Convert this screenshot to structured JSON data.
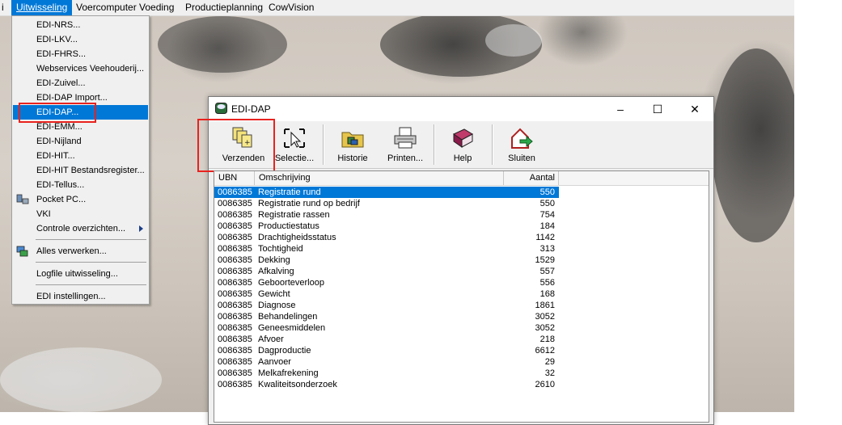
{
  "menubar": {
    "items": [
      {
        "label": "i"
      },
      {
        "label": "Uitwisseling"
      },
      {
        "label": "Voercomputer"
      },
      {
        "label": "Voeding"
      },
      {
        "label": "Productieplanning"
      },
      {
        "label": "CowVision"
      }
    ]
  },
  "dropdown": {
    "items": [
      {
        "label": "EDI-NRS..."
      },
      {
        "label": "EDI-LKV..."
      },
      {
        "label": "EDI-FHRS..."
      },
      {
        "label": "Webservices Veehouderij..."
      },
      {
        "label": "EDI-Zuivel..."
      },
      {
        "label": "EDI-DAP Import..."
      },
      {
        "label": "EDI-DAP..."
      },
      {
        "label": "EDI-EMM..."
      },
      {
        "label": "EDI-Nijland"
      },
      {
        "label": "EDI-HIT..."
      },
      {
        "label": "EDI-HIT Bestandsregister..."
      },
      {
        "label": "EDI-Tellus..."
      },
      {
        "label": "Pocket PC..."
      },
      {
        "label": "VKI"
      },
      {
        "label": "Controle overzichten..."
      },
      {
        "label": "Alles verwerken..."
      },
      {
        "label": "Logfile uitwisseling..."
      },
      {
        "label": "EDI instellingen..."
      }
    ],
    "selected": "EDI-DAP...",
    "submenu_icon": "chevron-right-icon"
  },
  "dialog": {
    "title": "EDI-DAP",
    "toolbar": [
      {
        "label": "Verzenden",
        "icon": "send-documents-icon"
      },
      {
        "label": "Selectie...",
        "icon": "selection-cursor-icon"
      },
      {
        "label": "Historie",
        "icon": "history-folder-icon"
      },
      {
        "label": "Printen...",
        "icon": "printer-icon"
      },
      {
        "label": "Help",
        "icon": "help-book-icon"
      },
      {
        "label": "Sluiten",
        "icon": "exit-house-icon"
      }
    ],
    "columns": [
      "UBN",
      "Omschrijving",
      "Aantal"
    ],
    "rows": [
      {
        "ubn": "0086385",
        "desc": "Registratie rund",
        "count": "550"
      },
      {
        "ubn": "0086385",
        "desc": "Registratie rund op bedrijf",
        "count": "550"
      },
      {
        "ubn": "0086385",
        "desc": "Registratie rassen",
        "count": "754"
      },
      {
        "ubn": "0086385",
        "desc": "Productiestatus",
        "count": "184"
      },
      {
        "ubn": "0086385",
        "desc": "Drachtigheidsstatus",
        "count": "1142"
      },
      {
        "ubn": "0086385",
        "desc": "Tochtigheid",
        "count": "313"
      },
      {
        "ubn": "0086385",
        "desc": "Dekking",
        "count": "1529"
      },
      {
        "ubn": "0086385",
        "desc": "Afkalving",
        "count": "557"
      },
      {
        "ubn": "0086385",
        "desc": "Geboorteverloop",
        "count": "556"
      },
      {
        "ubn": "0086385",
        "desc": "Gewicht",
        "count": "168"
      },
      {
        "ubn": "0086385",
        "desc": "Diagnose",
        "count": "1861"
      },
      {
        "ubn": "0086385",
        "desc": "Behandelingen",
        "count": "3052"
      },
      {
        "ubn": "0086385",
        "desc": "Geneesmiddelen",
        "count": "3052"
      },
      {
        "ubn": "0086385",
        "desc": "Afvoer",
        "count": "218"
      },
      {
        "ubn": "0086385",
        "desc": "Dagproductie",
        "count": "6612"
      },
      {
        "ubn": "0086385",
        "desc": "Aanvoer",
        "count": "29"
      },
      {
        "ubn": "0086385",
        "desc": "Melkafrekening",
        "count": "32"
      },
      {
        "ubn": "0086385",
        "desc": "Kwaliteitsonderzoek",
        "count": "2610"
      }
    ],
    "selected_row": 0
  },
  "colors": {
    "highlight": "#0078d7",
    "annotation_box": "#e8221e"
  }
}
